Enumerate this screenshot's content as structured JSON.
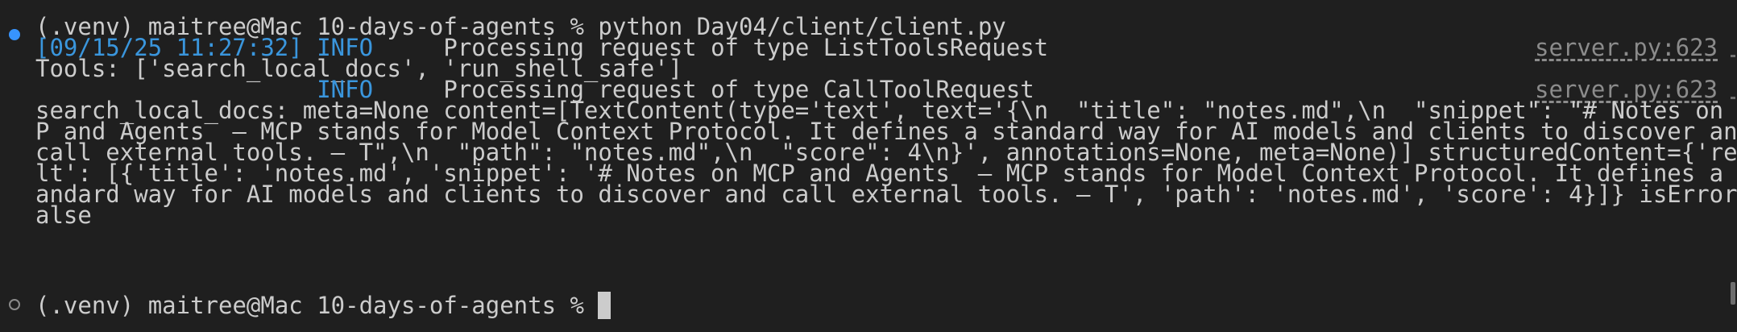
{
  "prompt": {
    "env": "(.venv)",
    "user_host": "maitree@Mac",
    "cwd": "10-days-of-agents",
    "symbol": "%"
  },
  "lines": [
    {
      "text": " python Day04/client/client.py"
    },
    {
      "timestamp": "[09/15/25 11:27:32]",
      "level": "INFO",
      "message": "Processing request of type ListToolsRequest",
      "source": "server.py:623"
    },
    {
      "text": "Tools: ['search_local_docs', 'run_shell_safe']"
    },
    {
      "level": "INFO",
      "message": "Processing request of type CallToolRequest",
      "source": "server.py:623"
    },
    {
      "text": "search_local_docs: meta=None content=[TextContent(type='text', text='{\\n  \"title\": \"notes.md\",\\n  \"snippet\": \"# Notes on MC"
    },
    {
      "text": "P and Agents  – MCP stands for Model Context Protocol. It defines a standard way for AI models and clients to discover and"
    },
    {
      "text": "call external tools. – T\",\\n  \"path\": \"notes.md\",\\n  \"score\": 4\\n}', annotations=None, meta=None)] structuredContent={'resu"
    },
    {
      "text": "lt': [{'title': 'notes.md', 'snippet': '# Notes on MCP and Agents  – MCP stands for Model Context Protocol. It defines a st"
    },
    {
      "text": "andard way for AI models and clients to discover and call external tools. – T', 'path': 'notes.md', 'score': 4}]} isError=F"
    },
    {
      "text": "alse"
    }
  ],
  "colors": {
    "background": "#1f1f1f",
    "foreground": "#cccccc",
    "info": "#3a96dd",
    "marker_done": "#3794ff",
    "dim": "#8b8b8b"
  }
}
